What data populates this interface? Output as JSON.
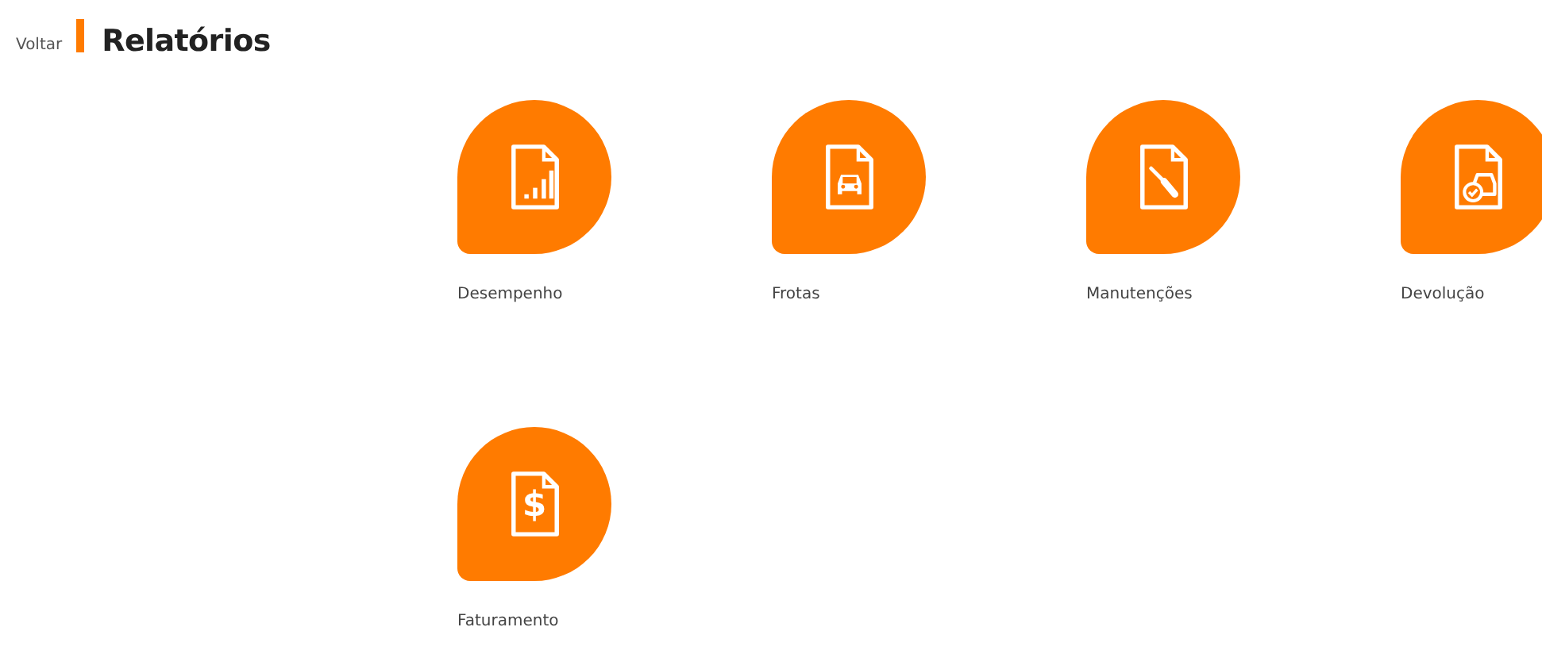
{
  "header": {
    "back_link": "Voltar",
    "title": "Relatórios"
  },
  "reports": [
    {
      "label": "Desempenho",
      "kind": "chart"
    },
    {
      "label": "Frotas",
      "kind": "car"
    },
    {
      "label": "Manutenções",
      "kind": "tool"
    },
    {
      "label": "Devolução",
      "kind": "car-check"
    },
    {
      "label": "Faturamento",
      "kind": "dollar",
      "symbol": "$"
    }
  ]
}
